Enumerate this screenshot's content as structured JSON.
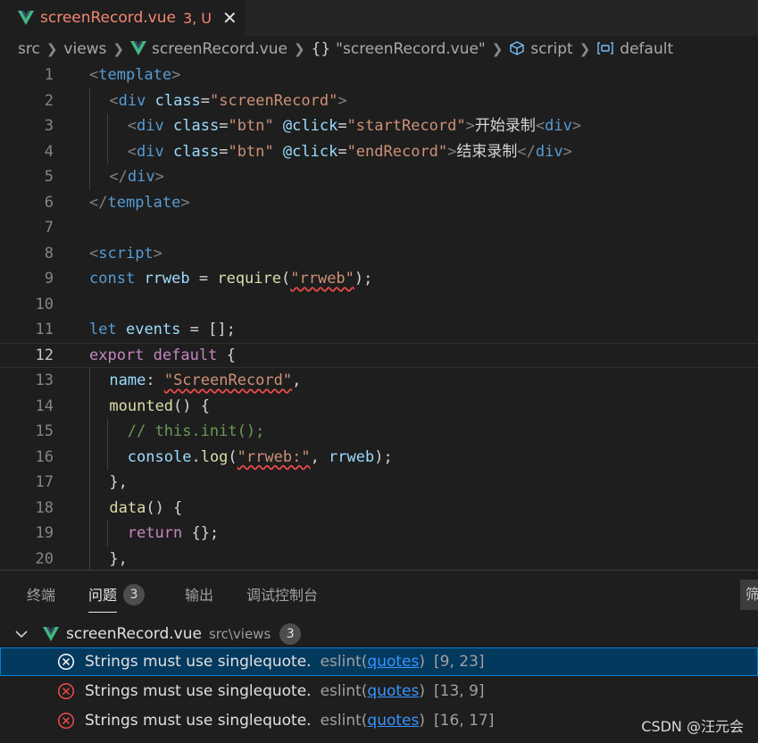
{
  "tab": {
    "filename": "screenRecord.vue",
    "status": "3, U",
    "close_glyph": "✕"
  },
  "breadcrumb": {
    "segments": [
      "src",
      "views",
      "screenRecord.vue",
      "\"screenRecord.vue\"",
      "script",
      "default"
    ],
    "braces": "{}"
  },
  "editor": {
    "current_line": 12,
    "lines": [
      {
        "n": 1,
        "indent": 0,
        "tokens": [
          [
            "t-tag",
            "<"
          ],
          [
            "t-name",
            "template"
          ],
          [
            "t-tag",
            ">"
          ]
        ]
      },
      {
        "n": 2,
        "indent": 1,
        "tokens": [
          [
            "t-tag",
            "<"
          ],
          [
            "t-name",
            "div"
          ],
          [
            "t-txt",
            " "
          ],
          [
            "t-attr",
            "class"
          ],
          [
            "t-txt",
            "="
          ],
          [
            "t-str",
            "\"screenRecord\""
          ],
          [
            "t-tag",
            ">"
          ]
        ]
      },
      {
        "n": 3,
        "indent": 2,
        "tokens": [
          [
            "t-tag",
            "<"
          ],
          [
            "t-name",
            "div"
          ],
          [
            "t-txt",
            " "
          ],
          [
            "t-attr",
            "class"
          ],
          [
            "t-txt",
            "="
          ],
          [
            "t-str",
            "\"btn\""
          ],
          [
            "t-txt",
            " "
          ],
          [
            "t-attr",
            "@click"
          ],
          [
            "t-txt",
            "="
          ],
          [
            "t-str",
            "\"startRecord\""
          ],
          [
            "t-tag",
            ">"
          ],
          [
            "t-txt",
            "开始录制"
          ],
          [
            "t-tag",
            "<"
          ],
          [
            "t-name",
            "div"
          ],
          [
            "t-tag",
            ">"
          ]
        ]
      },
      {
        "n": 4,
        "indent": 2,
        "tokens": [
          [
            "t-tag",
            "<"
          ],
          [
            "t-name",
            "div"
          ],
          [
            "t-txt",
            " "
          ],
          [
            "t-attr",
            "class"
          ],
          [
            "t-txt",
            "="
          ],
          [
            "t-str",
            "\"btn\""
          ],
          [
            "t-txt",
            " "
          ],
          [
            "t-attr",
            "@click"
          ],
          [
            "t-txt",
            "="
          ],
          [
            "t-str",
            "\"endRecord\""
          ],
          [
            "t-tag",
            ">"
          ],
          [
            "t-txt",
            "结束录制"
          ],
          [
            "t-tag",
            "</"
          ],
          [
            "t-name",
            "div"
          ],
          [
            "t-tag",
            ">"
          ]
        ]
      },
      {
        "n": 5,
        "indent": 1,
        "tokens": [
          [
            "t-tag",
            "</"
          ],
          [
            "t-name",
            "div"
          ],
          [
            "t-tag",
            ">"
          ]
        ]
      },
      {
        "n": 6,
        "indent": 0,
        "tokens": [
          [
            "t-tag",
            "</"
          ],
          [
            "t-name",
            "template"
          ],
          [
            "t-tag",
            ">"
          ]
        ]
      },
      {
        "n": 7,
        "indent": 0,
        "tokens": []
      },
      {
        "n": 8,
        "indent": 0,
        "tokens": [
          [
            "t-tag",
            "<"
          ],
          [
            "t-name",
            "script"
          ],
          [
            "t-tag",
            ">"
          ]
        ]
      },
      {
        "n": 9,
        "indent": 0,
        "tokens": [
          [
            "t-kw",
            "const"
          ],
          [
            "t-txt",
            " "
          ],
          [
            "t-var",
            "rrweb"
          ],
          [
            "t-txt",
            " = "
          ],
          [
            "t-fn",
            "require"
          ],
          [
            "t-txt",
            "("
          ],
          [
            "t-str squiggle",
            "\"rrweb\""
          ],
          [
            "t-txt",
            ");"
          ]
        ]
      },
      {
        "n": 10,
        "indent": 0,
        "tokens": []
      },
      {
        "n": 11,
        "indent": 0,
        "tokens": [
          [
            "t-kw",
            "let"
          ],
          [
            "t-txt",
            " "
          ],
          [
            "t-var",
            "events"
          ],
          [
            "t-txt",
            " = [];"
          ]
        ]
      },
      {
        "n": 12,
        "indent": 0,
        "tokens": [
          [
            "t-ctrl",
            "export"
          ],
          [
            "t-txt",
            " "
          ],
          [
            "t-ctrl",
            "default"
          ],
          [
            "t-txt",
            " {"
          ]
        ]
      },
      {
        "n": 13,
        "indent": 1,
        "tokens": [
          [
            "t-var",
            "name"
          ],
          [
            "t-txt",
            ": "
          ],
          [
            "t-str squiggle",
            "\"ScreenRecord\""
          ],
          [
            "t-txt",
            ","
          ]
        ]
      },
      {
        "n": 14,
        "indent": 1,
        "tokens": [
          [
            "t-fn",
            "mounted"
          ],
          [
            "t-txt",
            "() {"
          ]
        ]
      },
      {
        "n": 15,
        "indent": 2,
        "tokens": [
          [
            "t-com",
            "// this.init();"
          ]
        ]
      },
      {
        "n": 16,
        "indent": 2,
        "tokens": [
          [
            "t-var",
            "console"
          ],
          [
            "t-txt",
            "."
          ],
          [
            "t-fn",
            "log"
          ],
          [
            "t-txt",
            "("
          ],
          [
            "t-str squiggle",
            "\"rrweb:\""
          ],
          [
            "t-txt",
            ", "
          ],
          [
            "t-var",
            "rrweb"
          ],
          [
            "t-txt",
            ");"
          ]
        ]
      },
      {
        "n": 17,
        "indent": 1,
        "tokens": [
          [
            "t-txt",
            "},"
          ]
        ]
      },
      {
        "n": 18,
        "indent": 1,
        "tokens": [
          [
            "t-fn",
            "data"
          ],
          [
            "t-txt",
            "() {"
          ]
        ]
      },
      {
        "n": 19,
        "indent": 2,
        "tokens": [
          [
            "t-ctrl",
            "return"
          ],
          [
            "t-txt",
            " {};"
          ]
        ]
      },
      {
        "n": 20,
        "indent": 1,
        "tokens": [
          [
            "t-txt",
            "},"
          ]
        ]
      }
    ]
  },
  "panel": {
    "tabs": [
      "终端",
      "问题",
      "输出",
      "调试控制台"
    ],
    "problems_count": "3",
    "filter_text": "筛",
    "group": {
      "file": "screenRecord.vue",
      "path": "src\\views",
      "count": "3"
    },
    "problems": [
      {
        "message": "Strings must use singlequote.",
        "source": "eslint(",
        "rule": "quotes",
        "close": ")",
        "pos": "[9, 23]"
      },
      {
        "message": "Strings must use singlequote.",
        "source": "eslint(",
        "rule": "quotes",
        "close": ")",
        "pos": "[13, 9]"
      },
      {
        "message": "Strings must use singlequote.",
        "source": "eslint(",
        "rule": "quotes",
        "close": ")",
        "pos": "[16, 17]"
      }
    ]
  },
  "watermark": "CSDN @汪元会",
  "colors": {
    "accent": "#007fd4",
    "error": "#f14c4c",
    "vue_green": "#41b883",
    "modified": "#f48771"
  }
}
